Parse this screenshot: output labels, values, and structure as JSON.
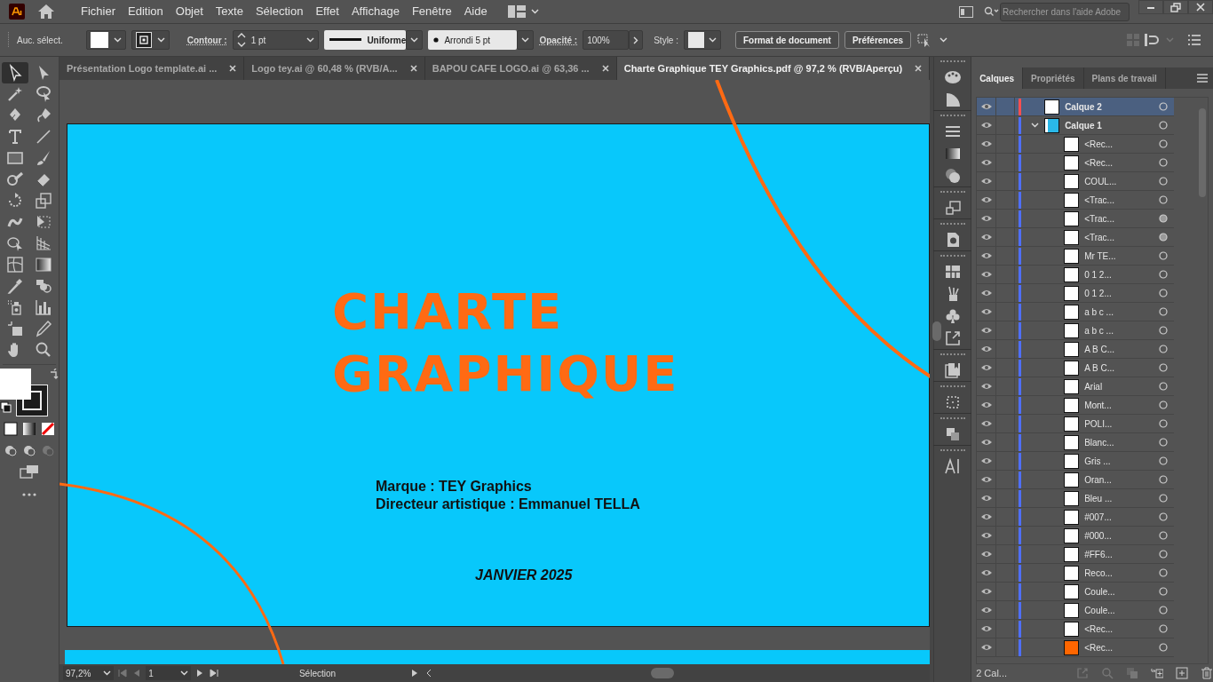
{
  "menu": [
    "Fichier",
    "Edition",
    "Objet",
    "Texte",
    "Sélection",
    "Effet",
    "Affichage",
    "Fenêtre",
    "Aide"
  ],
  "search": {
    "placeholder": "Rechercher dans l'aide Adobe"
  },
  "control_bar": {
    "selection_label": "Auc. sélect.",
    "stroke_label": "Contour :",
    "stroke_weight": "1 pt",
    "stroke_profile": "Uniforme",
    "brush": "Arrondi 5 pt",
    "opacity_label": "Opacité :",
    "opacity": "100%",
    "style_label": "Style :",
    "buttons": [
      "Format de document",
      "Préférences"
    ]
  },
  "tabs": [
    {
      "label": "Présentation Logo template.ai ...",
      "selected": false
    },
    {
      "label": "Logo tey.ai @ 60,48 % (RVB/A...",
      "selected": false
    },
    {
      "label": "BAPOU CAFE LOGO.ai @ 63,36 ...",
      "selected": false
    },
    {
      "label": "Charte Graphique TEY Graphics.pdf @ 97,2 %  (RVB/Aperçu)",
      "selected": true
    }
  ],
  "tools": [
    {
      "kind": "selection",
      "selected": true
    },
    {
      "kind": "direct",
      "selected": false
    },
    {
      "kind": "wand",
      "selected": false
    },
    {
      "kind": "lasso",
      "selected": false
    },
    {
      "kind": "pen",
      "selected": false
    },
    {
      "kind": "curvature",
      "selected": false
    },
    {
      "kind": "type",
      "selected": false
    },
    {
      "kind": "line",
      "selected": false
    },
    {
      "kind": "rectangle",
      "selected": false
    },
    {
      "kind": "brush",
      "selected": false
    },
    {
      "kind": "shaper",
      "selected": false
    },
    {
      "kind": "eraser",
      "selected": false
    },
    {
      "kind": "rotate",
      "selected": false
    },
    {
      "kind": "scale",
      "selected": false
    },
    {
      "kind": "warp",
      "selected": false
    },
    {
      "kind": "transform",
      "selected": false
    },
    {
      "kind": "builder",
      "selected": false
    },
    {
      "kind": "perspective",
      "selected": false
    },
    {
      "kind": "mesh",
      "selected": false
    },
    {
      "kind": "gradient",
      "selected": false
    },
    {
      "kind": "eyedropper",
      "selected": false
    },
    {
      "kind": "blend",
      "selected": false
    },
    {
      "kind": "sprayer",
      "selected": false
    },
    {
      "kind": "graph",
      "selected": false
    },
    {
      "kind": "artboard",
      "selected": false
    },
    {
      "kind": "slice",
      "selected": false
    },
    {
      "kind": "hand",
      "selected": false
    },
    {
      "kind": "zoom",
      "selected": false
    }
  ],
  "artboard": {
    "title_lines": [
      "CHARTE",
      "GRAPHIQUE"
    ],
    "info_lines": [
      "Marque : TEY Graphics",
      "Directeur artistique : Emmanuel TELLA"
    ],
    "date": "JANVIER 2025"
  },
  "layers_panel": {
    "tabs": [
      {
        "label": "Calques",
        "selected": true
      },
      {
        "label": "Propriétés",
        "selected": false
      },
      {
        "label": "Plans de travail",
        "selected": false
      }
    ],
    "layers": [
      {
        "name": "Calque 2",
        "color": "#ff4f4f",
        "selected": true,
        "appearance": false
      },
      {
        "name": "Calque 1",
        "color": "#4f6fff",
        "selected": false,
        "appearance": false,
        "expanded": true,
        "children": [
          {
            "name": "<Rec...",
            "color": "#ffffff",
            "appearance": false
          },
          {
            "name": "<Rec...",
            "color": "#ffffff",
            "appearance": false
          },
          {
            "name": "COUL...",
            "color": "#ffffff",
            "appearance": false
          },
          {
            "name": "<Trac...",
            "color": "#ffffff",
            "appearance": false
          },
          {
            "name": "<Trac...",
            "color": "#ffffff",
            "appearance": true
          },
          {
            "name": "<Trac...",
            "color": "#ffffff",
            "appearance": true
          },
          {
            "name": "Mr TE...",
            "color": "#ffffff",
            "appearance": false
          },
          {
            "name": "0 1 2...",
            "color": "#ffffff",
            "appearance": false
          },
          {
            "name": "0 1 2...",
            "color": "#ffffff",
            "appearance": false
          },
          {
            "name": "a b c ...",
            "color": "#ffffff",
            "appearance": false
          },
          {
            "name": "a b c ...",
            "color": "#ffffff",
            "appearance": false
          },
          {
            "name": "A B C...",
            "color": "#ffffff",
            "appearance": false
          },
          {
            "name": "A B C...",
            "color": "#ffffff",
            "appearance": false
          },
          {
            "name": "Arial",
            "color": "#ffffff",
            "appearance": false
          },
          {
            "name": "Mont...",
            "color": "#ffffff",
            "appearance": false
          },
          {
            "name": "POLI...",
            "color": "#ffffff",
            "appearance": false
          },
          {
            "name": "Blanc...",
            "color": "#ffffff",
            "appearance": false
          },
          {
            "name": "Gris ...",
            "color": "#ffffff",
            "appearance": false
          },
          {
            "name": "Oran...",
            "color": "#ffffff",
            "appearance": false
          },
          {
            "name": "Bleu ...",
            "color": "#ffffff",
            "appearance": false
          },
          {
            "name": "#007...",
            "color": "#ffffff",
            "appearance": false
          },
          {
            "name": "#000...",
            "color": "#ffffff",
            "appearance": false
          },
          {
            "name": "#FF6...",
            "color": "#ffffff",
            "appearance": false
          },
          {
            "name": "Reco...",
            "color": "#ffffff",
            "appearance": false
          },
          {
            "name": "Coule...",
            "color": "#ffffff",
            "appearance": false
          },
          {
            "name": "Coule...",
            "color": "#ffffff",
            "appearance": false
          },
          {
            "name": "<Rec...",
            "color": "#ffffff",
            "appearance": false
          },
          {
            "name": "<Rec...",
            "color": "#ff6600",
            "appearance": false
          }
        ]
      }
    ],
    "footer_count": "2 Cal..."
  },
  "status_bar": {
    "zoom": "97,2%",
    "page": "1",
    "mode": "Sélection"
  }
}
